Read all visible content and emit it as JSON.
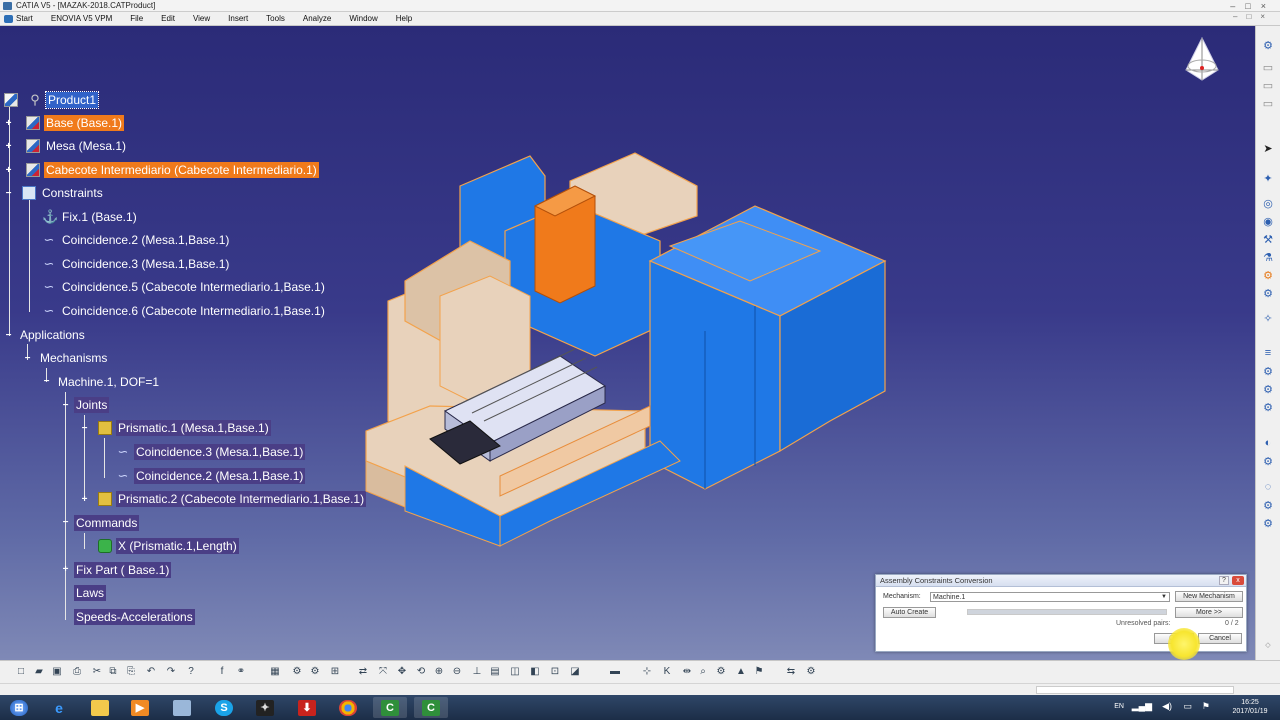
{
  "window": {
    "title": "CATIA V5 - [MAZAK-2018.CATProduct]"
  },
  "menu": {
    "items": [
      "Start",
      "ENOVIA V5 VPM",
      "File",
      "Edit",
      "View",
      "Insert",
      "Tools",
      "Analyze",
      "Window",
      "Help"
    ]
  },
  "tree": {
    "root": "Product1",
    "base": "Base (Base.1)",
    "mesa": "Mesa (Mesa.1)",
    "cabecote": "Cabecote Intermediario (Cabecote Intermediario.1)",
    "constraints": "Constraints",
    "fix": "Fix.1 (Base.1)",
    "coin2": "Coincidence.2 (Mesa.1,Base.1)",
    "coin3": "Coincidence.3 (Mesa.1,Base.1)",
    "coin5": "Coincidence.5 (Cabecote Intermediario.1,Base.1)",
    "coin6": "Coincidence.6 (Cabecote Intermediario.1,Base.1)",
    "applications": "Applications",
    "mechanisms": "Mechanisms",
    "machine": "Machine.1, DOF=1",
    "joints": "Joints",
    "prismatic1": "Prismatic.1 (Mesa.1,Base.1)",
    "jcoin3": "Coincidence.3 (Mesa.1,Base.1)",
    "jcoin2": "Coincidence.2 (Mesa.1,Base.1)",
    "prismatic2": "Prismatic.2 (Cabecote Intermediario.1,Base.1)",
    "commands": "Commands",
    "cmd_x": "X (Prismatic.1,Length)",
    "fixpart": "Fix Part ( Base.1)",
    "laws": "Laws",
    "speeds": "Speeds-Accelerations"
  },
  "dialog": {
    "title": "Assembly Constraints Conversion",
    "mechanism_label": "Mechanism:",
    "mechanism_value": "Machine.1",
    "new_mechanism": "New Mechanism",
    "auto_create": "Auto Create",
    "more": "More >>",
    "unresolved_label": "Unresolved pairs:",
    "unresolved_count": "0 / 2",
    "progress": 1.0,
    "ok": "OK",
    "cancel": "Cancel",
    "help": "?",
    "close": "x"
  },
  "taskbar": {
    "lang": "EN",
    "time": "16:25",
    "date": "2017/01/19"
  },
  "icons": {
    "compass": "compass-icon",
    "brand": "catia-logo"
  },
  "colors": {
    "bg_top": "#2b2b78",
    "bg_bottom": "#7f89b6",
    "select_blue": "#3162c8",
    "select_orange": "#f07a1b",
    "model_blue": "#1f78e6",
    "model_beige": "#e8d2bb"
  }
}
